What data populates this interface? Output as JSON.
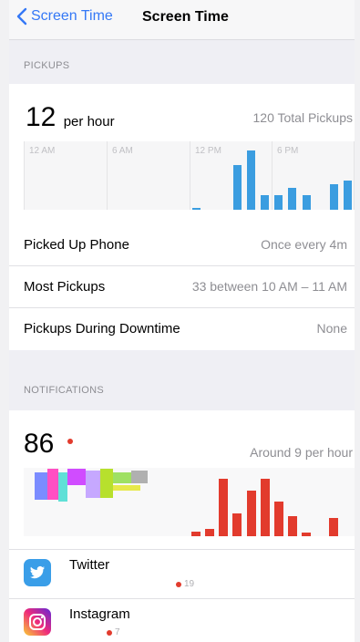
{
  "nav": {
    "back_label": "Screen Time",
    "title": "Screen Time"
  },
  "pickups": {
    "section_title": "PICKUPS",
    "rate_value": "12",
    "rate_unit": "per hour",
    "total": "120 Total Pickups",
    "chart_ticks": [
      "12 AM",
      "6 AM",
      "12 PM",
      "6 PM"
    ],
    "rows": [
      {
        "label": "Picked Up Phone",
        "value": "Once every 4m"
      },
      {
        "label": "Most Pickups",
        "value": "33 between 10 AM – 11 AM"
      },
      {
        "label": "Pickups During Downtime",
        "value": "None"
      }
    ]
  },
  "notifications": {
    "section_title": "NOTIFICATIONS",
    "count": "86",
    "rate": "Around 9 per hour",
    "apps": [
      {
        "name": "Twitter",
        "count": "19",
        "color": "#3a9ee8"
      },
      {
        "name": "Instagram",
        "count": "7",
        "color": "#c13584"
      }
    ]
  },
  "colors": {
    "accent": "#3478f6",
    "pickup_bar": "#3b9de0",
    "notif_bar": "#e23b2d"
  },
  "chart_data": [
    {
      "type": "bar",
      "x_ticks": [
        "12 AM",
        "6 AM",
        "12 PM",
        "6 PM"
      ],
      "values": [
        0,
        0,
        0,
        0,
        0,
        0,
        0,
        0,
        0,
        0,
        0,
        0,
        0.4,
        0,
        0,
        12,
        16,
        4,
        4,
        6,
        4,
        0,
        7,
        8
      ],
      "color": "#3b9de0"
    },
    {
      "type": "bar",
      "values": [
        0,
        0,
        0,
        0,
        0,
        0,
        0,
        0,
        0,
        0,
        0,
        0,
        0.8,
        1.2,
        10,
        4,
        8,
        10,
        6,
        3.5,
        0.6,
        0,
        3.2,
        0
      ],
      "color": "#e23b2d"
    }
  ]
}
